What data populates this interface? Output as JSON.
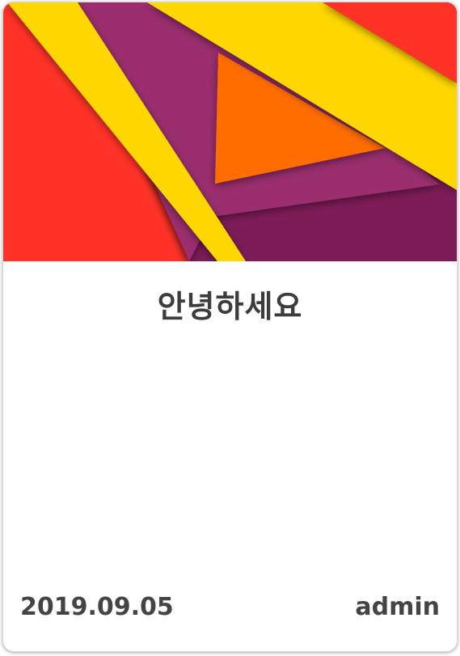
{
  "post": {
    "title": "안녕하세요",
    "date": "2019.09.05",
    "author": "admin"
  },
  "banner": {
    "image": "abstract-geometric-material-shapes",
    "colors": {
      "red": "#FF3227",
      "yellow": "#FFD700",
      "purple": "#9B2D6E",
      "plum": "#7E1C58",
      "orange": "#FF6D00"
    }
  }
}
